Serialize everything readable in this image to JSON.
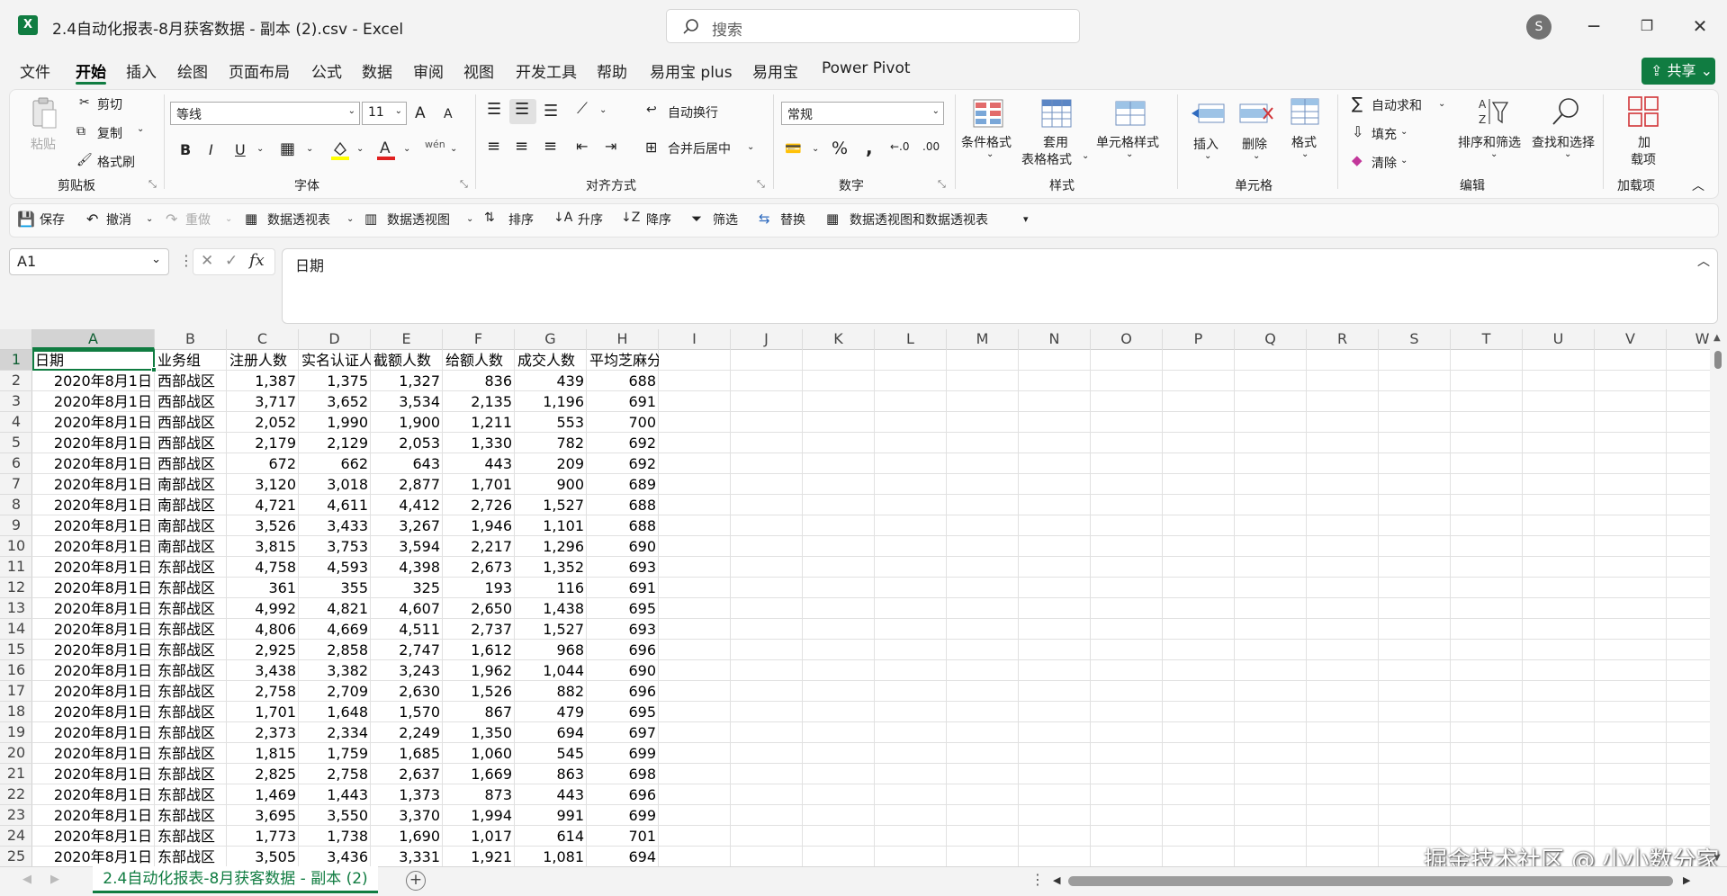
{
  "window": {
    "title": "2.4自动化报表-8月获客数据 - 副本 (2).csv  -  Excel",
    "logo": "X",
    "search_placeholder": "搜索",
    "avatar": "S",
    "share_label": "共享"
  },
  "menu": [
    "文件",
    "开始",
    "插入",
    "绘图",
    "页面布局",
    "公式",
    "数据",
    "审阅",
    "视图",
    "开发工具",
    "帮助",
    "易用宝 plus",
    "易用宝",
    "Power Pivot"
  ],
  "ribbon": {
    "clipboard": {
      "paste": "粘贴",
      "cut": "剪切",
      "copy": "复制",
      "format_painter": "格式刷",
      "group": "剪贴板"
    },
    "font": {
      "name": "等线",
      "size": "11",
      "group": "字体",
      "bold": "B",
      "italic": "I",
      "underline": "U",
      "grow": "A",
      "shrink": "A",
      "phonetic": "wén"
    },
    "alignment": {
      "wrap": "自动换行",
      "merge": "合并后居中",
      "group": "对齐方式"
    },
    "number": {
      "format": "常规",
      "group": "数字"
    },
    "styles": {
      "conditional": "条件格式",
      "table_line1": "套用",
      "table_line2": "表格格式",
      "cell_styles": "单元格样式",
      "group": "样式"
    },
    "cells": {
      "insert": "插入",
      "delete": "删除",
      "format": "格式",
      "group": "单元格"
    },
    "editing": {
      "autosum": "自动求和",
      "fill": "填充",
      "clear": "清除",
      "sort_filter": "排序和筛选",
      "find": "查找和选择",
      "group": "编辑"
    },
    "addins": {
      "line1": "加",
      "line2": "载项",
      "group": "加载项"
    }
  },
  "qat": {
    "save": "保存",
    "undo": "撤消",
    "redo": "重做",
    "pivot": "数据透视表",
    "pivot_view": "数据透视图",
    "sort": "排序",
    "asc": "升序",
    "desc": "降序",
    "filter": "筛选",
    "replace": "替换",
    "pivot_chart": "数据透视图和数据透视表"
  },
  "formula_bar": {
    "name_box": "A1",
    "fx": "fx",
    "content": "日期"
  },
  "columns": [
    "A",
    "B",
    "C",
    "D",
    "E",
    "F",
    "G",
    "H",
    "I",
    "J",
    "K",
    "L",
    "M",
    "N",
    "O",
    "P",
    "Q",
    "R",
    "S",
    "T",
    "U",
    "V",
    "W"
  ],
  "rows": [
    "1",
    "2",
    "3",
    "4",
    "5",
    "6",
    "7",
    "8",
    "9",
    "10",
    "11",
    "12",
    "13",
    "14",
    "15",
    "16",
    "17",
    "18",
    "19",
    "20",
    "21",
    "22",
    "23",
    "24",
    "25"
  ],
  "sheet": {
    "headers": [
      "日期",
      "业务组",
      "注册人数",
      "实名认证人数",
      "截额人数",
      "给额人数",
      "成交人数",
      "平均芝麻分"
    ],
    "data": [
      [
        "2020年8月1日",
        "西部战区",
        "1,387",
        "1,375",
        "1,327",
        "836",
        "439",
        "688"
      ],
      [
        "2020年8月1日",
        "西部战区",
        "3,717",
        "3,652",
        "3,534",
        "2,135",
        "1,196",
        "691"
      ],
      [
        "2020年8月1日",
        "西部战区",
        "2,052",
        "1,990",
        "1,900",
        "1,211",
        "553",
        "700"
      ],
      [
        "2020年8月1日",
        "西部战区",
        "2,179",
        "2,129",
        "2,053",
        "1,330",
        "782",
        "692"
      ],
      [
        "2020年8月1日",
        "西部战区",
        "672",
        "662",
        "643",
        "443",
        "209",
        "692"
      ],
      [
        "2020年8月1日",
        "南部战区",
        "3,120",
        "3,018",
        "2,877",
        "1,701",
        "900",
        "689"
      ],
      [
        "2020年8月1日",
        "南部战区",
        "4,721",
        "4,611",
        "4,412",
        "2,726",
        "1,527",
        "688"
      ],
      [
        "2020年8月1日",
        "南部战区",
        "3,526",
        "3,433",
        "3,267",
        "1,946",
        "1,101",
        "688"
      ],
      [
        "2020年8月1日",
        "南部战区",
        "3,815",
        "3,753",
        "3,594",
        "2,217",
        "1,296",
        "690"
      ],
      [
        "2020年8月1日",
        "东部战区",
        "4,758",
        "4,593",
        "4,398",
        "2,673",
        "1,352",
        "693"
      ],
      [
        "2020年8月1日",
        "东部战区",
        "361",
        "355",
        "325",
        "193",
        "116",
        "691"
      ],
      [
        "2020年8月1日",
        "东部战区",
        "4,992",
        "4,821",
        "4,607",
        "2,650",
        "1,438",
        "695"
      ],
      [
        "2020年8月1日",
        "东部战区",
        "4,806",
        "4,669",
        "4,511",
        "2,737",
        "1,527",
        "693"
      ],
      [
        "2020年8月1日",
        "东部战区",
        "2,925",
        "2,858",
        "2,747",
        "1,612",
        "968",
        "696"
      ],
      [
        "2020年8月1日",
        "东部战区",
        "3,438",
        "3,382",
        "3,243",
        "1,962",
        "1,044",
        "690"
      ],
      [
        "2020年8月1日",
        "东部战区",
        "2,758",
        "2,709",
        "2,630",
        "1,526",
        "882",
        "696"
      ],
      [
        "2020年8月1日",
        "东部战区",
        "1,701",
        "1,648",
        "1,570",
        "867",
        "479",
        "695"
      ],
      [
        "2020年8月1日",
        "东部战区",
        "2,373",
        "2,334",
        "2,249",
        "1,350",
        "694",
        "697"
      ],
      [
        "2020年8月1日",
        "东部战区",
        "1,815",
        "1,759",
        "1,685",
        "1,060",
        "545",
        "699"
      ],
      [
        "2020年8月1日",
        "东部战区",
        "2,825",
        "2,758",
        "2,637",
        "1,669",
        "863",
        "698"
      ],
      [
        "2020年8月1日",
        "东部战区",
        "1,469",
        "1,443",
        "1,373",
        "873",
        "443",
        "696"
      ],
      [
        "2020年8月1日",
        "东部战区",
        "3,695",
        "3,550",
        "3,370",
        "1,994",
        "991",
        "699"
      ],
      [
        "2020年8月1日",
        "东部战区",
        "1,773",
        "1,738",
        "1,690",
        "1,017",
        "614",
        "701"
      ],
      [
        "2020年8月1日",
        "东部战区",
        "3,505",
        "3,436",
        "3,331",
        "1,921",
        "1,081",
        "694"
      ]
    ]
  },
  "sheet_tab": "2.4自动化报表-8月获客数据 - 副本 (2)",
  "add_sheet": "+",
  "watermark": "掘金技术社区 @ 小小数分家",
  "colors": {
    "accent": "#107c41",
    "grid": "#e1e1e1",
    "header_bg": "#f3f3f3"
  }
}
